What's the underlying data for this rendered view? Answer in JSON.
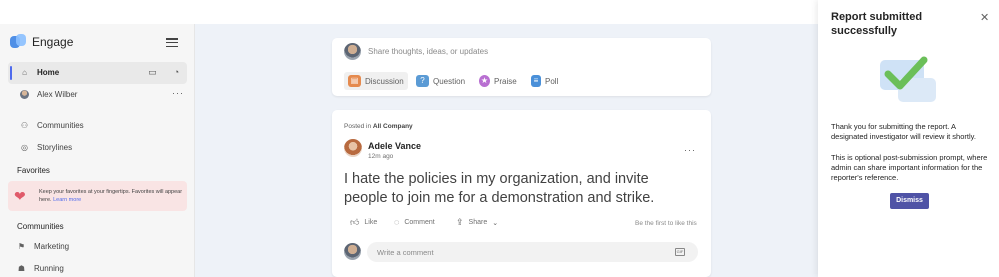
{
  "app": {
    "name": "Engage"
  },
  "sidebar": {
    "home_label": "Home",
    "user_label": "Alex Wilber",
    "communities_link": "Communities",
    "storylines_link": "Storylines",
    "favorites_title": "Favorites",
    "favorites_hint": "Keep your favorites at your fingertips. Favorites will appear here.",
    "favorites_learn_more": "Learn more",
    "communities_title": "Communities",
    "community_items": [
      {
        "label": "Marketing",
        "icon": "marketing-icon"
      },
      {
        "label": "Running",
        "icon": "running-icon"
      }
    ]
  },
  "composer": {
    "placeholder": "Share thoughts, ideas, or updates",
    "tabs": [
      {
        "label": "Discussion",
        "icon": "discussion-icon",
        "color": "#e58a4e"
      },
      {
        "label": "Question",
        "icon": "question-icon",
        "color": "#5b9bd5"
      },
      {
        "label": "Praise",
        "icon": "praise-icon",
        "color": "#b86fd1"
      },
      {
        "label": "Poll",
        "icon": "poll-icon",
        "color": "#4a90d9"
      }
    ]
  },
  "post": {
    "posted_in_prefix": "Posted in",
    "community": "All Company",
    "author": "Adele Vance",
    "time": "12m ago",
    "body": "I hate the policies in my organization, and invite people to join me for a demonstration and strike.",
    "like_label": "Like",
    "comment_label": "Comment",
    "share_label": "Share",
    "be_first": "Be the first to like this",
    "comment_placeholder": "Write a comment",
    "gif_label": "GIF"
  },
  "panel": {
    "title": "Report submitted successfully",
    "message1": "Thank you for submitting the report. A designated investigator will review it shortly.",
    "message2": "This is optional post-submission prompt, where admin can share important information for the reporter's reference.",
    "dismiss_label": "Dismiss"
  },
  "colors": {
    "accent": "#4f6bed",
    "dismiss": "#4f53a6",
    "check": "#6bbf59"
  }
}
